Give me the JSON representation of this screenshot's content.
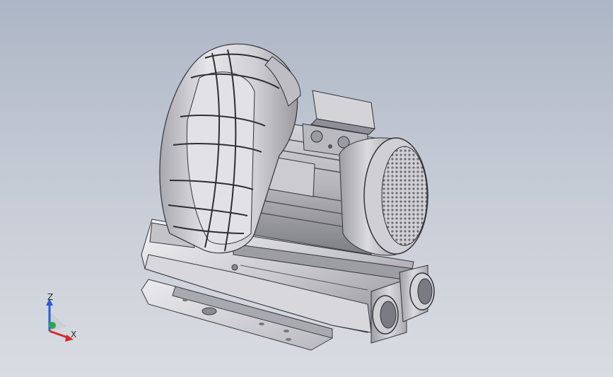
{
  "viewport": {
    "background_top": "#adb6c6",
    "background_bottom": "#d9dce2"
  },
  "model": {
    "subject": "side-channel-blower-3d-model"
  },
  "triad": {
    "z_label": "Z",
    "x_label": "X",
    "colors": {
      "z": "#2a5bd6",
      "x": "#d62a2a",
      "y": "#2aa84a"
    }
  }
}
